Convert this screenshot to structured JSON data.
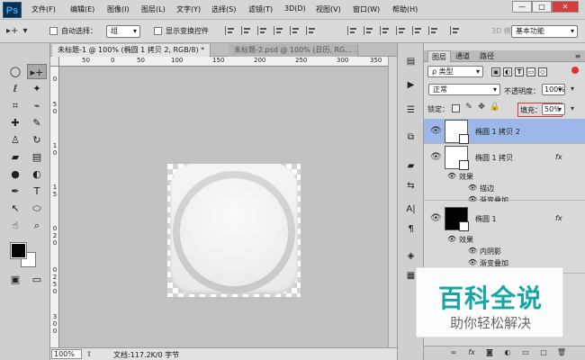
{
  "app": {
    "logo": "Ps",
    "menus": [
      "文件(F)",
      "编辑(E)",
      "图像(I)",
      "图层(L)",
      "文字(Y)",
      "选择(S)",
      "滤镜(T)",
      "3D(D)",
      "视图(V)",
      "窗口(W)",
      "帮助(H)"
    ],
    "window_buttons": [
      "—",
      "□",
      "✕"
    ]
  },
  "options": {
    "auto_select_label": "自动选择：",
    "auto_select_value": "组",
    "transform_label": "显示变换控件",
    "mode3d": "3D 模",
    "workspace": "基本功能"
  },
  "tabs": [
    {
      "label": "未标题-1 @ 100% (椭圆 1 拷贝 2, RGB/8) *"
    },
    {
      "label": "未标题-2.psd @ 100% (日历, RG..."
    }
  ],
  "rulers": {
    "h": [
      "50",
      "0",
      "50",
      "100",
      "150",
      "200",
      "250",
      "300",
      "350"
    ],
    "v": [
      "0",
      "5",
      "0",
      "1",
      "0",
      "1",
      "5",
      "0",
      "2",
      "0",
      "0",
      "2",
      "5",
      "0",
      "3",
      "0",
      "0"
    ]
  },
  "status": {
    "zoom": "100%",
    "doc": "文档:117.2K/0 字节"
  },
  "layers": {
    "tabs": [
      "图层",
      "通道",
      "路径"
    ],
    "filter": "ρ 类型",
    "blend": "正常",
    "opacity_label": "不透明度：",
    "opacity": "100%",
    "lock_label": "锁定：",
    "fill_label": "填充：",
    "fill": "50%",
    "items": [
      {
        "name": "椭圆 1 拷贝 2",
        "selected": true,
        "fx": ""
      },
      {
        "name": "椭圆 1 拷贝",
        "fx": "fx",
        "effects_label": "效果",
        "effects": [
          "描边",
          "渐变叠加"
        ]
      },
      {
        "name": "椭圆 1",
        "fx": "fx",
        "effects_label": "效果",
        "effects": [
          "内阴影",
          "渐变叠加"
        ]
      }
    ]
  },
  "watermark": {
    "main": "百科全说",
    "sub": "助你轻松解决"
  }
}
